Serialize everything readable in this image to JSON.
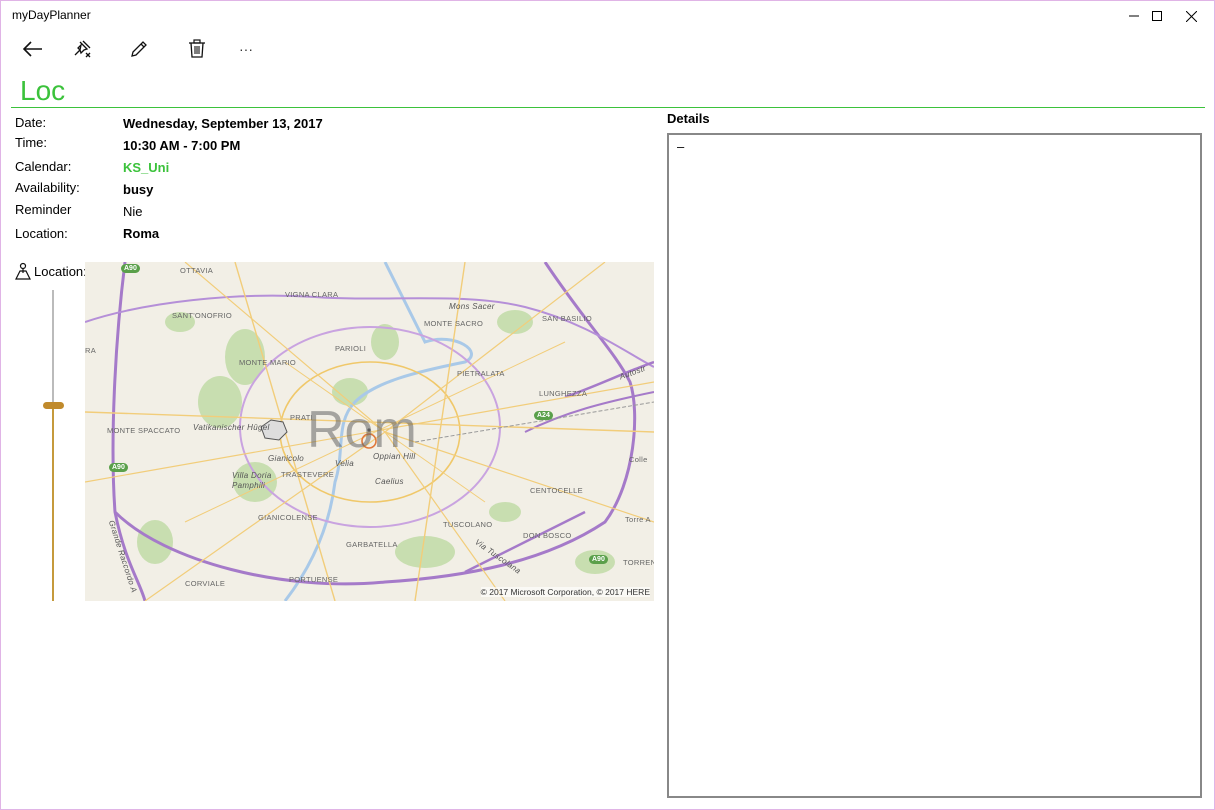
{
  "window": {
    "title": "myDayPlanner",
    "buttons": [
      "minimize",
      "maximize",
      "close"
    ]
  },
  "toolbar": {
    "items": [
      {
        "icon": "back-arrow-icon"
      },
      {
        "icon": "pin-icon"
      },
      {
        "icon": "edit-pencil-icon"
      },
      {
        "icon": "delete-trash-icon"
      },
      {
        "icon": "more-ellipsis-icon",
        "label": "···"
      }
    ]
  },
  "event": {
    "title": "Loc",
    "fields": [
      {
        "label": "Date:",
        "value": "Wednesday, September 13, 2017",
        "style": "bold"
      },
      {
        "label": "Time:",
        "value": "10:30 AM - 7:00 PM",
        "style": "bold"
      },
      {
        "label": "Calendar:",
        "value": "KS_Uni",
        "style": "green"
      },
      {
        "label": "Availability:",
        "value": "busy",
        "style": "bold"
      },
      {
        "label": "Reminder",
        "value": "Nie",
        "style": "plain"
      },
      {
        "label": "Location:",
        "value": "Roma",
        "style": "bold"
      }
    ],
    "location_label": "Location:"
  },
  "map": {
    "city_label": "Rom",
    "places": [
      "OTTAVIA",
      "VIGNA CLARA",
      "Mons Sacer",
      "SANT'ONOFRIO",
      "MONTE SACRO",
      "SAN BASILIO",
      "PARIOLI",
      "MONTE MARIO",
      "PIETRALATA",
      "LUNGHEZZA",
      "PRATI",
      "MONTE SPACCATO",
      "Vatikanischer Hügel",
      "Gianicolo",
      "Velia",
      "Oppian Hill",
      "Villa Doria Pamphili",
      "TRASTEVERE",
      "Caelius",
      "CENTOCELLE",
      "Colle",
      "GIANICOLENSE",
      "TUSCOLANO",
      "Torre A",
      "DON BOSCO",
      "GARBATELLA",
      "Via Tuscolana",
      "TORREN",
      "CORVIALE",
      "PORTUENSE",
      "Grande Raccordo A",
      "Autostr",
      "RA"
    ],
    "shields": [
      "A90",
      "A90",
      "A24",
      "A90"
    ],
    "copyright": "© 2017 Microsoft Corporation, © 2017 HERE",
    "zoom_level": 0.62
  },
  "details": {
    "label": "Details",
    "text": "–"
  },
  "colors": {
    "accent": "#3bc23b",
    "slider": "#c08a2c"
  }
}
